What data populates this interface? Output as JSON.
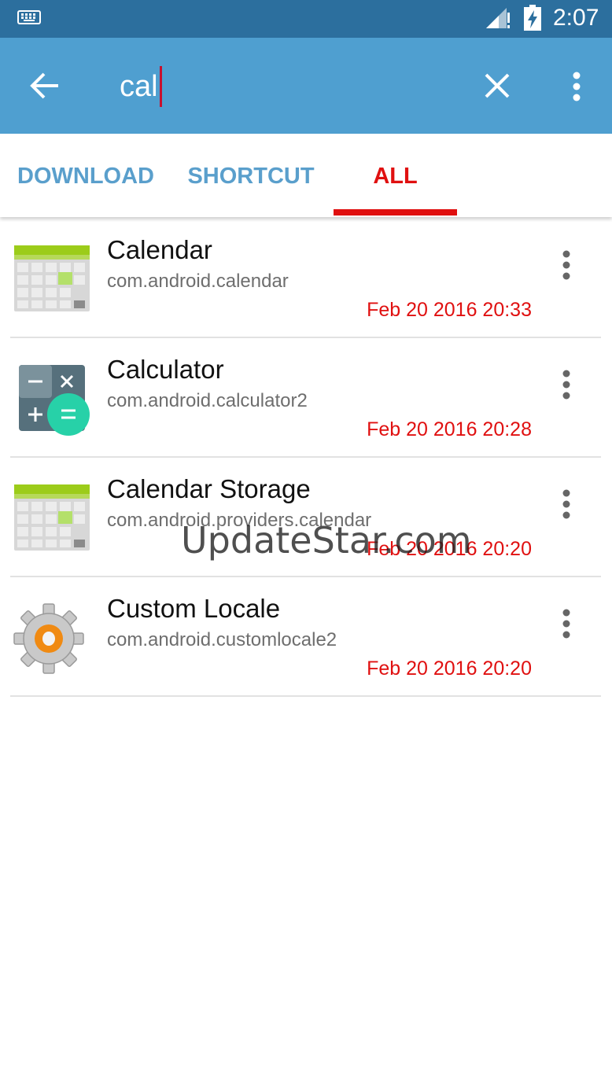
{
  "status_bar": {
    "time": "2:07",
    "icons": [
      "keyboard-icon",
      "signal-icon",
      "battery-charging-icon"
    ]
  },
  "app_bar": {
    "search_value": "cal",
    "icons": [
      "back-arrow-icon",
      "close-icon",
      "more-vert-icon"
    ],
    "color": "#4f9fd0"
  },
  "tabs": [
    {
      "label": "DOWNLOAD",
      "active": false
    },
    {
      "label": "SHORTCUT",
      "active": false
    },
    {
      "label": "ALL",
      "active": true
    }
  ],
  "apps": [
    {
      "name": "Calendar",
      "package": "com.android.calendar",
      "date": "Feb 20 2016 20:33",
      "icon": "calendar-icon"
    },
    {
      "name": "Calculator",
      "package": "com.android.calculator2",
      "date": "Feb 20 2016 20:28",
      "icon": "calculator-icon"
    },
    {
      "name": "Calendar Storage",
      "package": "com.android.providers.calendar",
      "date": "Feb 20 2016 20:20",
      "icon": "calendar-icon"
    },
    {
      "name": "Custom Locale",
      "package": "com.android.customlocale2",
      "date": "Feb 20 2016 20:20",
      "icon": "gear-icon"
    }
  ],
  "watermark": "UpdateStar.com",
  "colors": {
    "status_bar": "#2c6f9e",
    "accent": "#e01010",
    "tab_inactive": "#5a9fcc"
  }
}
